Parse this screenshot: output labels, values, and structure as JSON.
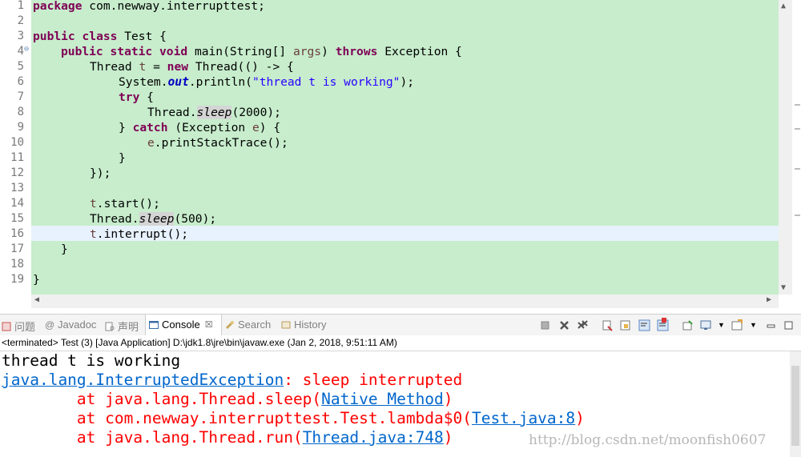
{
  "editor": {
    "line_numbers": [
      "1",
      "2",
      "3",
      "4",
      "5",
      "6",
      "7",
      "8",
      "9",
      "10",
      "11",
      "12",
      "13",
      "14",
      "15",
      "16",
      "17",
      "18",
      "19"
    ],
    "lines": {
      "l1": {
        "kw": "package",
        "rest": " com.newway.interrupttest;"
      },
      "l3": {
        "kw": "public class",
        "rest": " Test {"
      },
      "l4": {
        "kw1": "public static void",
        "mid": " main(String[] ",
        "param": "args",
        "mid2": ") ",
        "kw2": "throws",
        "rest": " Exception {"
      },
      "l5": {
        "pre": "Thread ",
        "var": "t",
        "eq": " = ",
        "kw": "new",
        "rest": " Thread(() -> {"
      },
      "l6": {
        "pre": "System.",
        "fld": "out",
        "mid": ".println(",
        "str": "\"thread t is working\"",
        "rest": ");"
      },
      "l7": {
        "kw": "try",
        "rest": " {"
      },
      "l8": {
        "pre": "Thread.",
        "stat": "sleep",
        "rest": "(2000);"
      },
      "l9": {
        "pre": "} ",
        "kw": "catch",
        "mid": " (Exception ",
        "param": "e",
        "rest": ") {"
      },
      "l10": {
        "param": "e",
        "rest": ".printStackTrace();"
      },
      "l11": {
        "text": "}"
      },
      "l12": {
        "text": "});"
      },
      "l14": {
        "param": "t",
        "rest": ".start();"
      },
      "l15": {
        "pre": "Thread.",
        "stat": "sleep",
        "rest": "(500);"
      },
      "l16": {
        "param": "t",
        "rest": ".interrupt();"
      },
      "l17": {
        "text": "}"
      },
      "l19": {
        "text": "}"
      }
    }
  },
  "tabs": {
    "problems": "问题",
    "javadoc": "Javadoc",
    "declaration": "声明",
    "console": "Console",
    "console_close": "☒",
    "search": "Search",
    "history": "History"
  },
  "toolbar_icons": [
    "terminate-icon",
    "remove-launch-icon",
    "remove-all-icon",
    "clear-console-icon",
    "scroll-lock-icon",
    "word-wrap-icon",
    "show-stdout-icon",
    "show-stderr-icon",
    "pin-console-icon",
    "display-console-icon",
    "open-console-icon",
    "minimize-icon",
    "maximize-icon"
  ],
  "status": "<terminated> Test (3) [Java Application] D:\\jdk1.8\\jre\\bin\\javaw.exe (Jan 2, 2018, 9:51:11 AM)",
  "console": {
    "line1": "thread t is working",
    "line2_link": "java.lang.InterruptedException",
    "line2_rest": ": sleep interrupted",
    "line3_pre": "        at java.lang.Thread.sleep(",
    "line3_link": "Native Method",
    "line3_post": ")",
    "line4_pre": "        at com.newway.interrupttest.Test.lambda$0(",
    "line4_link": "Test.java:8",
    "line4_post": ")",
    "line5_pre": "        at java.lang.Thread.run(",
    "line5_link": "Thread.java:748",
    "line5_post": ")"
  },
  "watermark": "http://blog.csdn.net/moonfish0607",
  "colors": {
    "editor_bg": "#c7edcc",
    "current_line": "#e8f2fe",
    "keyword": "#7f0055",
    "string": "#2a00ff",
    "error_text": "#ff0000",
    "link": "#0066cc"
  }
}
